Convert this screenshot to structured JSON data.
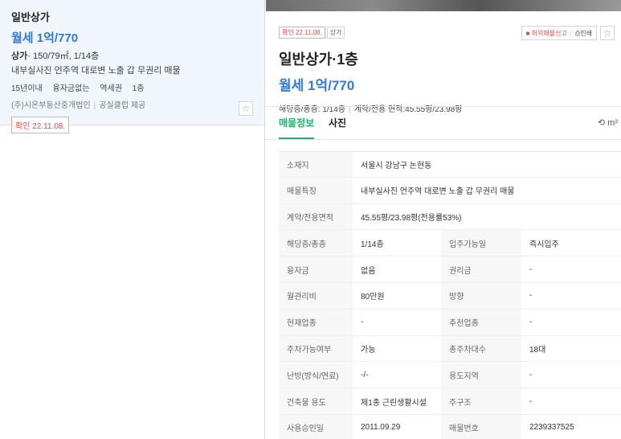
{
  "list": {
    "card": {
      "type": "일반상가",
      "price": "월세 1억/770",
      "spec_type": "상가",
      "spec_rest": "· 150/79㎡, 1/14층",
      "description": "내부실사진 언주역 대로변 노출 갑 무권리 매물",
      "tags": [
        "15년이내",
        "융자금없는",
        "역세권",
        "1층"
      ],
      "agency": "(주)시온부동산중개법인",
      "provider": "공실클럽 제공",
      "confirm": "확인 22.11.08."
    }
  },
  "detail": {
    "tags": [
      "확인 22.11.08.",
      "상가"
    ],
    "actions": {
      "report": "허위매물신고",
      "print": "인쇄"
    },
    "title": "일반상가·1층",
    "price": "월세 1억/770",
    "floor_info": "해당층/총층: 1/14층",
    "area_info": "계약/전용 면적:45.55평/23.98평",
    "tabs": [
      "매물정보",
      "사진"
    ],
    "tools_label": "m²",
    "table": {
      "address_label": "소재지",
      "address": "서울시 강남구 논현동",
      "feature_label": "매물특징",
      "feature": "내부실사진 언주역 대로변 노출 갑 무권리 매물",
      "area_label": "계약/전용면적",
      "area": "45.55평/23.98평(전용률53%)",
      "rows": [
        {
          "k": "해당층/총층",
          "v": "1/14층",
          "k2": "입주가능일",
          "v2": "즉시입주"
        },
        {
          "k": "융자금",
          "v": "없음",
          "k2": "권리금",
          "v2": "-"
        },
        {
          "k": "월관리비",
          "v": "80만원",
          "k2": "방향",
          "v2": "-"
        },
        {
          "k": "현재업종",
          "v": "-",
          "k2": "추천업종",
          "v2": "-"
        },
        {
          "k": "주차가능여부",
          "v": "가능",
          "k2": "총주차대수",
          "v2": "18대"
        },
        {
          "k": "난방(방식/연료)",
          "v": "-/-",
          "k2": "용도지역",
          "v2": "-"
        },
        {
          "k": "건축물 용도",
          "v": "제1종 근린생활시설",
          "k2": "주구조",
          "v2": "-"
        },
        {
          "k": "사용승인일",
          "v": "2011.09.29",
          "k2": "매물번호",
          "v2": "2239337525"
        }
      ]
    }
  },
  "colors": {
    "accent_blue": "#2f7ad8",
    "accent_green": "#23b26b",
    "alert_red": "#e04848"
  }
}
